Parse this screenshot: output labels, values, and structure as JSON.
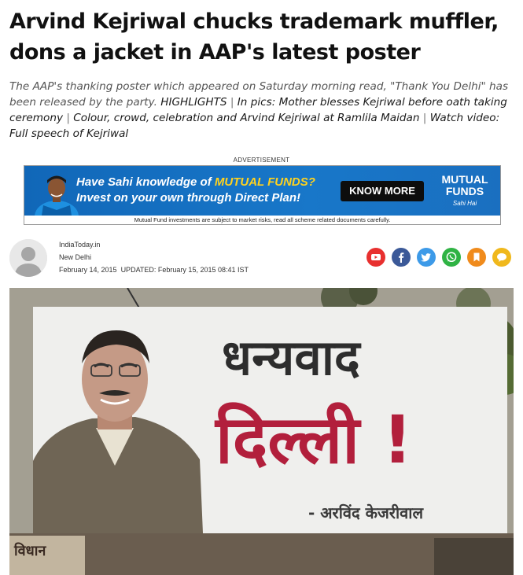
{
  "article": {
    "headline": "Arvind Kejriwal chucks trademark muffler, dons a jacket in AAP's latest poster",
    "summary_intro": "The AAP's thanking poster which appeared on Saturday morning read, \"Thank You Delhi\" has been released by the party.",
    "highlights_label": "HIGHLIGHTS",
    "links": [
      "In pics: Mother blesses Kejriwal before oath taking ceremony",
      "Colour, crowd, celebration and Arvind Kejriwal at Ramlila Maidan",
      "Watch video: Full speech of Kejriwal"
    ]
  },
  "advertisement": {
    "label": "ADVERTISEMENT",
    "line1_prefix": "Have Sahi knowledge of ",
    "line1_accent": "MUTUAL FUNDS?",
    "line2": "Invest on your own through Direct Plan!",
    "cta": "KNOW MORE",
    "brand_line1": "MUTUAL",
    "brand_line2": "FUNDS",
    "brand_tag": "Sahi Hai",
    "disclaimer": "Mutual Fund investments are subject to market risks, read all scheme related documents carefully.",
    "colors": {
      "background": "#1877c9",
      "accent": "#ffd21f",
      "cta": "#0d0d0d"
    }
  },
  "byline": {
    "source": "IndiaToday.in",
    "city": "New Delhi",
    "published": "February 14, 2015",
    "updated_label": "UPDATED:",
    "updated": "February 15, 2015 08:41 IST"
  },
  "share_icons": [
    {
      "name": "youtube-icon",
      "color": "#e8302f"
    },
    {
      "name": "facebook-icon",
      "color": "#3b5998"
    },
    {
      "name": "twitter-icon",
      "color": "#3d9ae8"
    },
    {
      "name": "whatsapp-icon",
      "color": "#2fb344"
    },
    {
      "name": "bookmark-icon",
      "color": "#f08b1c"
    },
    {
      "name": "comment-icon",
      "color": "#f0b81c"
    }
  ],
  "hero_image": {
    "poster_line1": "धन्यवाद",
    "poster_line2": "दिल्ली !",
    "poster_signature": "- अरविंद केजरीवाल",
    "corner_sign": "विधान"
  }
}
